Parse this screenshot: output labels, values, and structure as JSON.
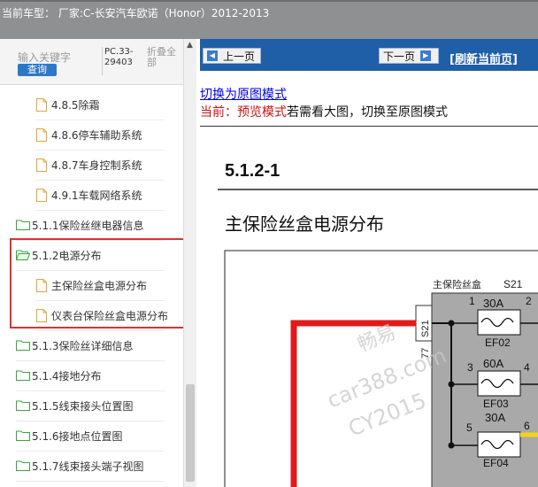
{
  "header": {
    "title": "当前车型：  厂家:C-长安汽车欧诺（Honor）2012-2013"
  },
  "search": {
    "keyword_placeholder": "输入关键字",
    "query_label": "查询",
    "pc_code": "PC.33-29403",
    "fold_all": "折叠全部"
  },
  "tree": {
    "items": [
      {
        "label": "4.8.5除霜",
        "type": "doc"
      },
      {
        "label": "4.8.6停车辅助系统",
        "type": "doc"
      },
      {
        "label": "4.8.7车身控制系统",
        "type": "doc"
      },
      {
        "label": "4.9.1车载网络系统",
        "type": "doc"
      },
      {
        "label": "5.1.1保险丝继电器信息",
        "type": "folder"
      },
      {
        "label": "5.1.2电源分布",
        "type": "folder-open"
      },
      {
        "label": "主保险丝盒电源分布",
        "type": "doc"
      },
      {
        "label": "仪表台保险丝盒电源分布",
        "type": "doc"
      },
      {
        "label": "5.1.3保险丝详细信息",
        "type": "folder"
      },
      {
        "label": "5.1.4接地分布",
        "type": "folder"
      },
      {
        "label": "5.1.5线束接头位置图",
        "type": "folder"
      },
      {
        "label": "5.1.6接地点位置图",
        "type": "folder"
      },
      {
        "label": "5.1.7线束接头端子视图",
        "type": "folder"
      }
    ]
  },
  "nav": {
    "prev_label": "上一页",
    "next_label": "下一页",
    "refresh_label": "[刷新当前页]"
  },
  "mode": {
    "switch_link": "切换为原图模式",
    "current_prefix": "当前：预览模式",
    "current_suffix": "若需看大图，切换至原图模式"
  },
  "document": {
    "section": "5.1.2-1",
    "title": "主保险丝盒电源分布",
    "box_label": "主保险丝盒",
    "box_code": "S21",
    "connector": "S21",
    "connector_pin": "77",
    "fuses": [
      {
        "pin_in": "1",
        "pin_out": "2",
        "amps": "30A",
        "name": "EF02"
      },
      {
        "pin_in": "3",
        "pin_out": "4",
        "amps": "60A",
        "name": "EF03"
      },
      {
        "pin_in": "5",
        "pin_out": "6",
        "amps": "30A",
        "name": "EF04"
      }
    ],
    "watermark": [
      "畅易",
      "car388.com",
      "CY2015"
    ]
  },
  "colors": {
    "topbar": "#8f9092",
    "nav": "#1f5fa7",
    "highlight": "#e03131",
    "wire_red": "#e01b1b",
    "wire_yellow": "#f3d21b",
    "fusebox": "#a9a9a9"
  }
}
